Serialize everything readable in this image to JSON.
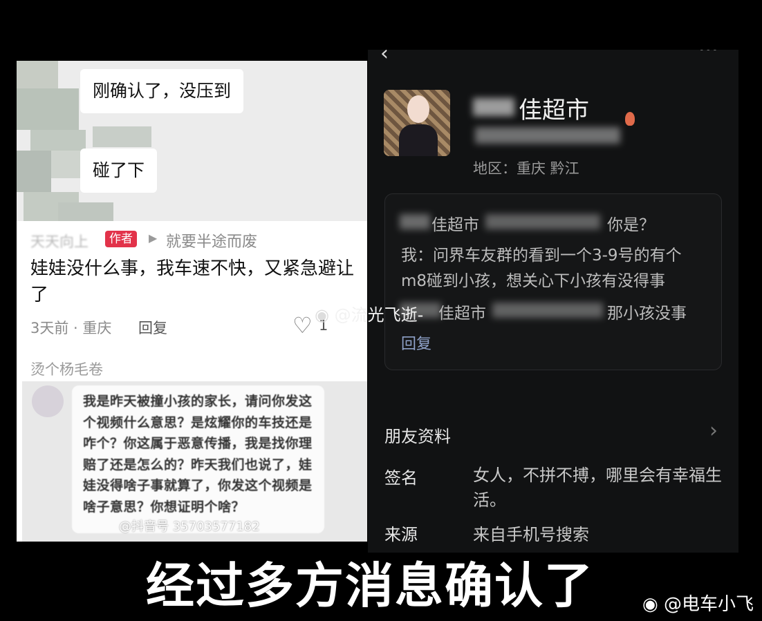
{
  "left": {
    "bubbles": [
      "刚确认了，没压到",
      "碰了下"
    ],
    "author_name": "天天向上",
    "author_tag": "作者",
    "author_reply_to": "就要半途而废",
    "author_comment": "娃娃没什么事，我车速不快，又紧急避让了",
    "comment_meta": "3天前 · 重庆",
    "reply_label": "回复",
    "like_count": "1",
    "second_user": "烫个杨毛卷",
    "parent_message": "我是昨天被撞小孩的家长，请问你发这个视频什么意思？是炫耀你的车技还是咋个？你这属于恶意传播，我是找你理赔了还是怎么的？昨天我们也说了，娃娃没得啥子事就算了，你发这个视频是啥子意思？你想证明个啥？",
    "image_watermark": "@抖音号 35703577182"
  },
  "right": {
    "profile_name": "佳超市",
    "region": "地区：重庆  黔江",
    "message_1_suffix": "你是？",
    "message_1_prefix": "佳超市",
    "message_2": "我：问界车友群的看到一个3-9号的有个m8碰到小孩，想关心下小孩有没得事",
    "message_3_prefix": "佳超市",
    "message_3_suffix": "那小孩没事",
    "reply_label": "回复",
    "friend_info_label": "朋友资料",
    "signature_label": "签名",
    "signature_value": "女人，不拼不搏，哪里会有幸福生活。",
    "source_label": "来源",
    "source_value": "来自手机号搜索"
  },
  "overlay": {
    "caption": "经过多方消息确认了",
    "watermark_right": "@电车小飞",
    "watermark_mid": "@流光飞逝-"
  },
  "colors": {
    "author_tag": "#e2334a",
    "reply_link_dark": "#8fa2c9",
    "dark_bg": "#111213"
  }
}
